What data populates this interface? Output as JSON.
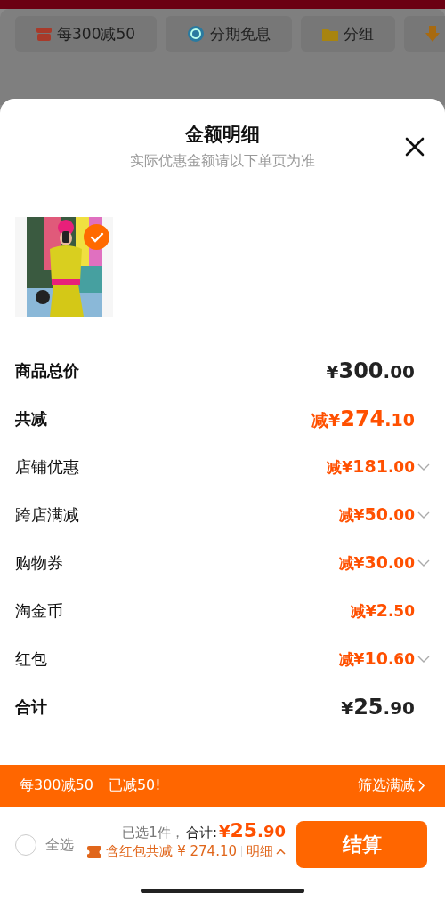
{
  "background": {
    "chips": [
      {
        "label": "每300减50",
        "kind": "gift"
      },
      {
        "label": "分期免息",
        "kind": "clock"
      },
      {
        "label": "分组",
        "kind": "folder"
      },
      {
        "kind": "download"
      }
    ]
  },
  "sheet": {
    "title": "金额明细",
    "subtitle": "实际优惠金额请以下单页为准",
    "product": {
      "kind": "picture",
      "checked": true
    },
    "rows": [
      {
        "label": "商品总价",
        "kind": "total",
        "prefix": "",
        "currency": "¥",
        "main": "300",
        "decimal": ".00",
        "expandable": false
      },
      {
        "label": "共减",
        "kind": "discount-total",
        "prefix": "减",
        "currency": "¥",
        "main": "274",
        "decimal": ".10",
        "expandable": false
      },
      {
        "label": "店铺优惠",
        "kind": "discount",
        "prefix": "减",
        "currency": "¥",
        "main": "181",
        "decimal": ".00",
        "expandable": true
      },
      {
        "label": "跨店满减",
        "kind": "discount",
        "prefix": "减",
        "currency": "¥",
        "main": "50",
        "decimal": ".00",
        "expandable": true
      },
      {
        "label": "购物券",
        "kind": "discount",
        "prefix": "减",
        "currency": "¥",
        "main": "30",
        "decimal": ".00",
        "expandable": true
      },
      {
        "label": "淘金币",
        "kind": "discount",
        "prefix": "减",
        "currency": "¥",
        "main": "2",
        "decimal": ".50",
        "expandable": false
      },
      {
        "label": "红包",
        "kind": "discount",
        "prefix": "减",
        "currency": "¥",
        "main": "10",
        "decimal": ".60",
        "expandable": true
      },
      {
        "label": "合计",
        "kind": "total",
        "prefix": "",
        "currency": "¥",
        "main": "25",
        "decimal": ".90",
        "expandable": false
      }
    ]
  },
  "promo_bar": {
    "rule": "每300减50",
    "status": "已减50!",
    "link": "筛选满减"
  },
  "footer": {
    "select_all": {
      "label": "全选",
      "checked": false
    },
    "selected_count": "已选1件，",
    "total_label": "合计:",
    "total_currency": "¥",
    "total_main": "25",
    "total_decimal": ".90",
    "savings": "含红包共减 ¥ 274.10",
    "detail_link": "明细",
    "checkout": "结算"
  }
}
